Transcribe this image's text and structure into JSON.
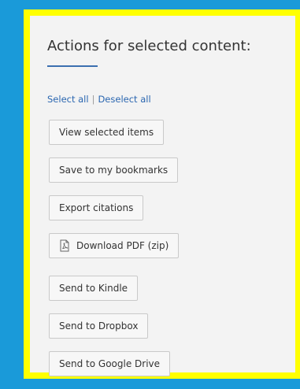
{
  "panel": {
    "title": "Actions for selected content:",
    "select_all": "Select all",
    "separator": "|",
    "deselect_all": "Deselect all"
  },
  "actions": [
    {
      "label": "View selected items"
    },
    {
      "label": "Save to my bookmarks"
    },
    {
      "label": "Export citations"
    },
    {
      "label": "Download PDF (zip)",
      "icon": "pdf-icon"
    },
    {
      "label": "Send to Kindle"
    },
    {
      "label": "Send to Dropbox"
    },
    {
      "label": "Send to Google Drive"
    }
  ],
  "colors": {
    "background": "#1a9ad9",
    "highlight": "#ffff00",
    "link": "#2a66b0",
    "accent": "#3b6fb0"
  }
}
